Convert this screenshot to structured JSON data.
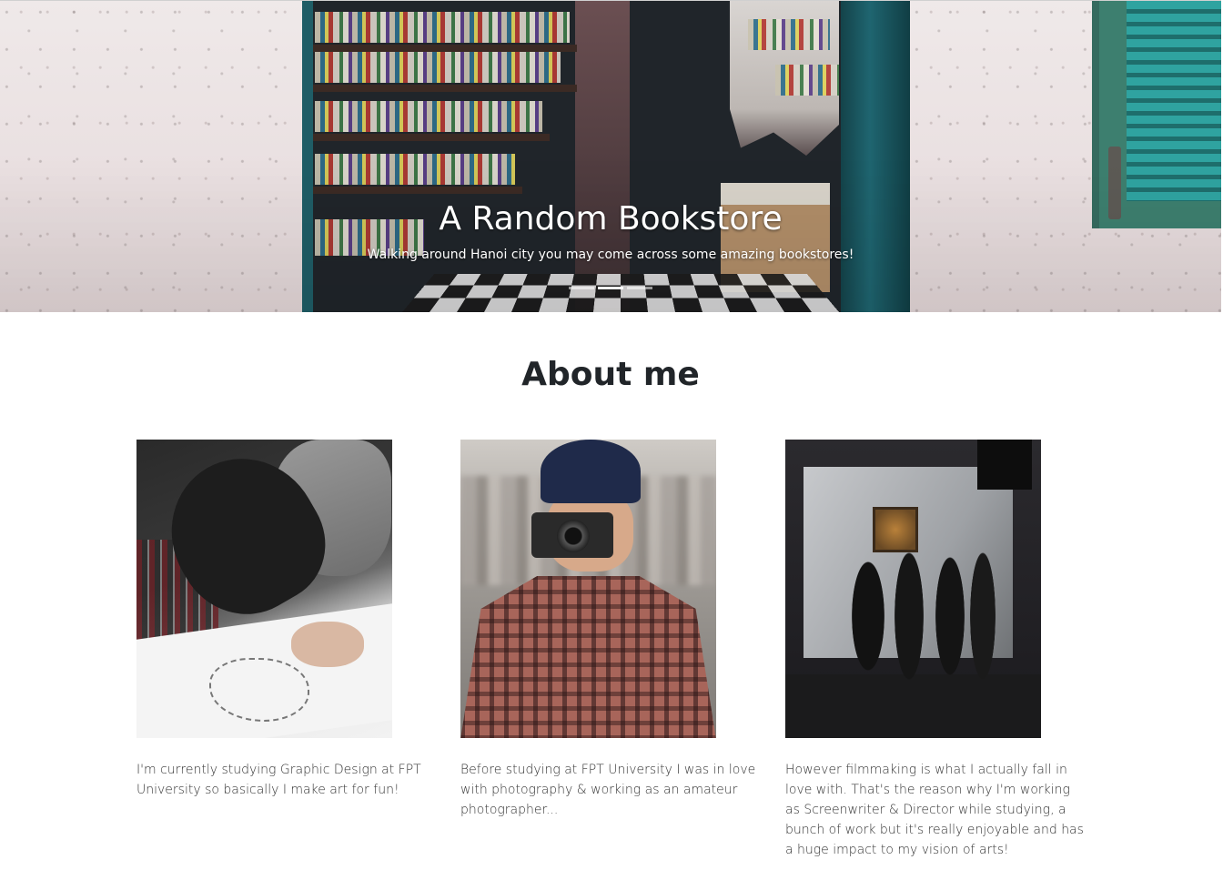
{
  "carousel": {
    "slide_title": "A Random Bookstore",
    "slide_caption": "Walking around Hanoi city you may come across some amazing bookstores!",
    "indicators": 3,
    "active_index": 1
  },
  "about": {
    "title": "About me",
    "cards": [
      {
        "text": "I'm currently studying Graphic Design at FPT University so basically I make art for fun!"
      },
      {
        "text": "Before studying at FPT University I was in love with photography & working as an amateur photographer..."
      },
      {
        "text": "However filmmaking is what I actually fall in love with. That's the reason why I'm working as Screenwriter & Director while studying, a bunch of work but it's really enjoyable and has a huge impact to my vision of arts!"
      }
    ]
  },
  "colors": {
    "text": "#212529",
    "body_text": "#333333",
    "indicator_active": "#ffffff"
  }
}
